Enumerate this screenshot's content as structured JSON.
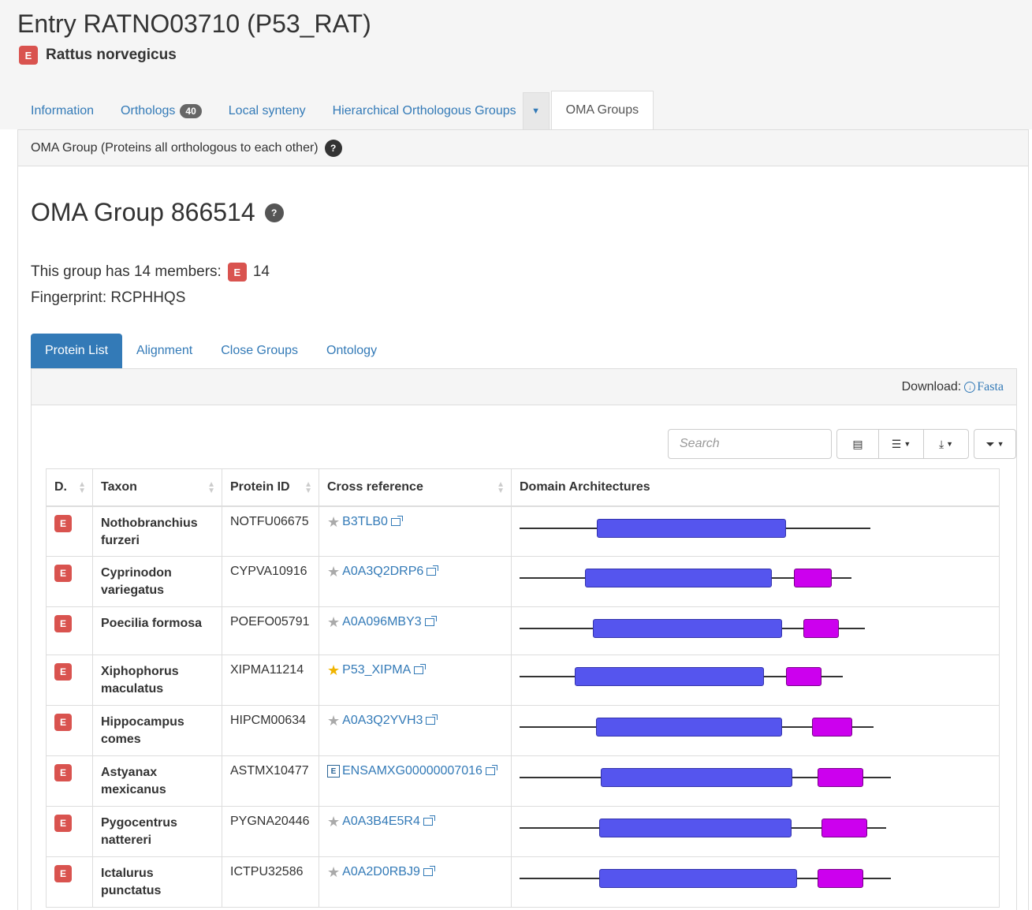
{
  "entry": {
    "title": "Entry RATNO03710 (P53_RAT)",
    "kingdom_badge": "E",
    "species": "Rattus norvegicus"
  },
  "tabs": [
    {
      "label": "Information"
    },
    {
      "label": "Orthologs",
      "count": "40"
    },
    {
      "label": "Local synteny"
    },
    {
      "label": "Hierarchical Orthologous Groups"
    },
    {
      "label": "OMA Groups",
      "active": true
    }
  ],
  "panel": {
    "heading": "OMA Group (Proteins all orthologous to each other)",
    "help_glyph": "?"
  },
  "group": {
    "title": "OMA Group 866514",
    "help_glyph": "?",
    "members_label": "This group has 14 members:",
    "members_badge": "E",
    "members_count": "14",
    "fingerprint": "Fingerprint: RCPHHQS"
  },
  "subtabs": [
    {
      "label": "Protein List",
      "active": true
    },
    {
      "label": "Alignment"
    },
    {
      "label": "Close Groups"
    },
    {
      "label": "Ontology"
    }
  ],
  "download": {
    "label": "Download:",
    "fasta": "Fasta"
  },
  "toolbar": {
    "search_placeholder": "Search"
  },
  "table": {
    "headers": [
      "D.",
      "Taxon",
      "Protein ID",
      "Cross reference",
      "Domain Architectures"
    ],
    "rows": [
      {
        "d": "E",
        "taxon": "Nothobranchius furzeri",
        "pid": "NOTFU06675",
        "xref": "B3TLB0",
        "xref_icon": "gray-star-icon",
        "arch": {
          "length": 1.0,
          "blue": [
            0.22,
            0.76
          ],
          "pink": null
        }
      },
      {
        "d": "E",
        "taxon": "Cyprinodon variegatus",
        "pid": "CYPVA10916",
        "xref": "A0A3Q2DRP6",
        "xref_icon": "gray-star-icon",
        "arch": {
          "length": 0.945,
          "blue": [
            0.187,
            0.72
          ],
          "pink": [
            0.782,
            0.89
          ]
        }
      },
      {
        "d": "E",
        "taxon": "Poecilia formosa",
        "pid": "POEFO05791",
        "xref": "A0A096MBY3",
        "xref_icon": "gray-star-icon",
        "arch": {
          "length": 0.985,
          "blue": [
            0.208,
            0.748
          ],
          "pink": [
            0.81,
            0.91
          ]
        }
      },
      {
        "d": "E",
        "taxon": "Xiphophorus maculatus",
        "pid": "XIPMA11214",
        "xref": "P53_XIPMA",
        "xref_icon": "gold-star-icon",
        "arch": {
          "length": 0.922,
          "blue": [
            0.157,
            0.697
          ],
          "pink": [
            0.76,
            0.86
          ]
        }
      },
      {
        "d": "E",
        "taxon": "Hippocampus comes",
        "pid": "HIPCM00634",
        "xref": "A0A3Q2YVH3",
        "xref_icon": "gray-star-icon",
        "arch": {
          "length": 1.01,
          "blue": [
            0.218,
            0.748
          ],
          "pink": [
            0.833,
            0.948
          ]
        }
      },
      {
        "d": "E",
        "taxon": "Astyanax mexicanus",
        "pid": "ASTMX10477",
        "xref": "ENSAMXG00000007016",
        "xref_icon": "ensembl-icon",
        "arch": {
          "length": 1.058,
          "blue": [
            0.232,
            0.778
          ],
          "pink": [
            0.85,
            0.98
          ]
        }
      },
      {
        "d": "E",
        "taxon": "Pygocentrus nattereri",
        "pid": "PYGNA20446",
        "xref": "A0A3B4E5R4",
        "xref_icon": "gray-star-icon",
        "arch": {
          "length": 1.045,
          "blue": [
            0.228,
            0.775
          ],
          "pink": [
            0.86,
            0.99
          ]
        }
      },
      {
        "d": "E",
        "taxon": "Ictalurus punctatus",
        "pid": "ICTPU32586",
        "xref": "A0A2D0RBJ9",
        "xref_icon": "gray-star-icon",
        "arch": {
          "length": 1.058,
          "blue": [
            0.228,
            0.79
          ],
          "pink": [
            0.85,
            0.98
          ]
        }
      }
    ]
  },
  "colors": {
    "link": "#337ab7",
    "badge": "#d9534f",
    "domain_blue": "#5555ee",
    "domain_pink": "#cc00ee"
  }
}
